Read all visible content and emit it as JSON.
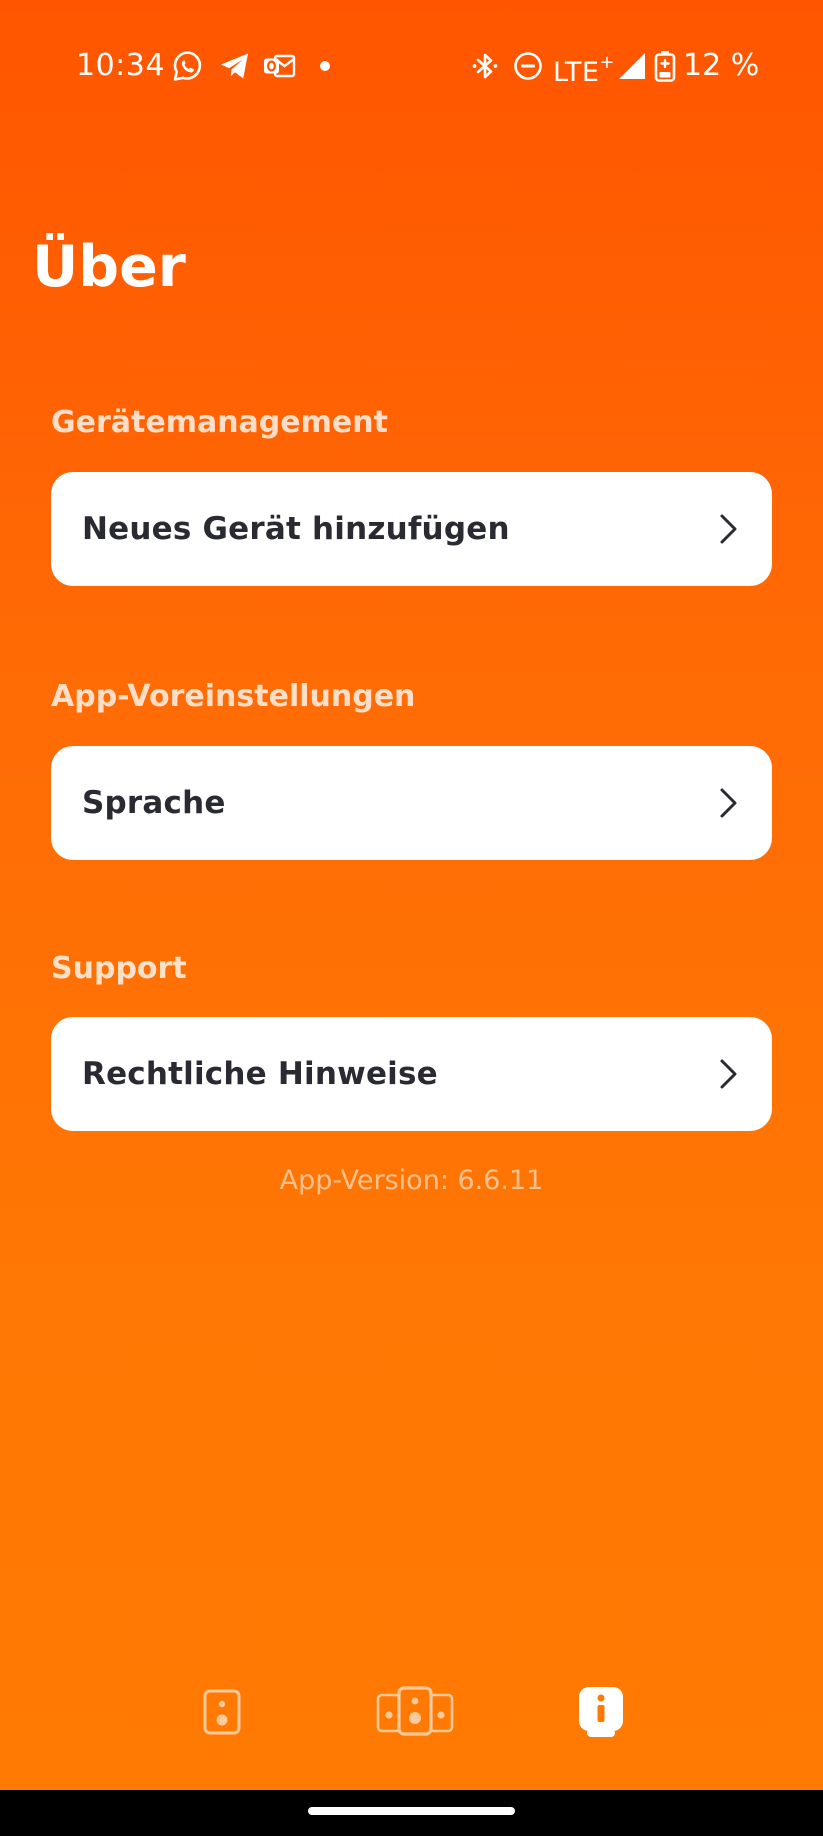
{
  "status_bar": {
    "time": "10:34",
    "network": "LTE",
    "network_suffix": "+",
    "battery": "12 %",
    "left_icons": [
      "whatsapp-icon",
      "telegram-icon",
      "outlook-icon",
      "notification-dot"
    ],
    "right_icons": [
      "bluetooth-icon",
      "do-not-disturb-icon",
      "signal-icon",
      "battery-charging-icon"
    ]
  },
  "page": {
    "title": "Über"
  },
  "sections": [
    {
      "heading": "Gerätemanagement",
      "item": "Neues Gerät hinzufügen"
    },
    {
      "heading": "App-Voreinstellungen",
      "item": "Sprache"
    },
    {
      "heading": "Support",
      "item": "Rechtliche Hinweise"
    }
  ],
  "footer": {
    "app_version": "App-Version: 6.6.11"
  },
  "bottom_nav": {
    "tabs": [
      {
        "icon": "single-speaker-icon",
        "active": false
      },
      {
        "icon": "multi-speaker-icon",
        "active": false
      },
      {
        "icon": "info-icon",
        "active": true
      }
    ]
  },
  "colors": {
    "background_top": "#FF5500",
    "background_bottom": "#FF7A03",
    "card": "#FFFFFF",
    "card_text": "#2A2A33"
  }
}
